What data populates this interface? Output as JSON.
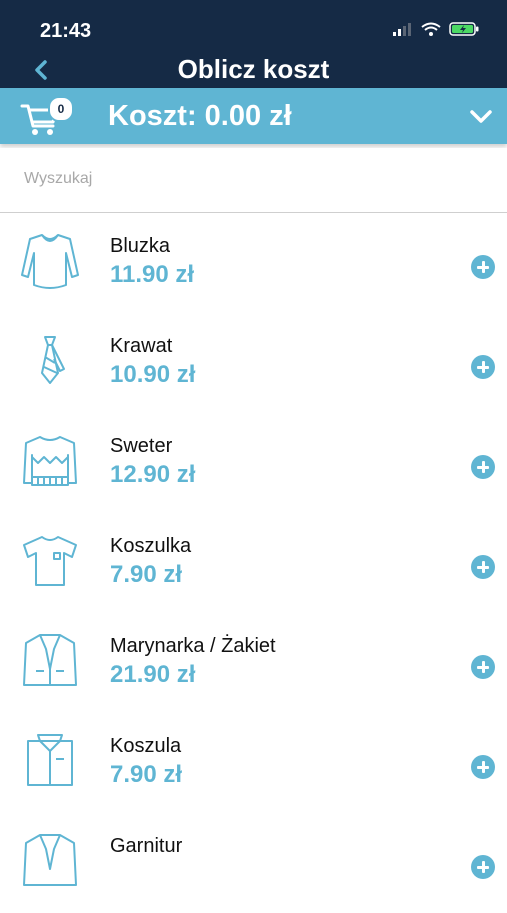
{
  "status": {
    "time": "21:43"
  },
  "nav": {
    "title": "Oblicz koszt",
    "back_icon": "chevron-left-icon"
  },
  "cost_bar": {
    "cart_count": "0",
    "label": "Koszt: 0.00 zł",
    "expand_icon": "chevron-down-icon"
  },
  "search": {
    "placeholder": "Wyszukaj",
    "value": ""
  },
  "items": [
    {
      "name": "Bluzka",
      "price": "11.90 zł",
      "icon": "blouse-icon"
    },
    {
      "name": "Krawat",
      "price": "10.90 zł",
      "icon": "tie-icon"
    },
    {
      "name": "Sweter",
      "price": "12.90 zł",
      "icon": "sweater-icon"
    },
    {
      "name": "Koszulka",
      "price": "7.90 zł",
      "icon": "tshirt-icon"
    },
    {
      "name": "Marynarka / Żakiet",
      "price": "21.90 zł",
      "icon": "jacket-icon"
    },
    {
      "name": "Koszula",
      "price": "7.90 zł",
      "icon": "shirt-icon"
    },
    {
      "name": "Garnitur",
      "price": "",
      "icon": "suit-icon"
    }
  ],
  "colors": {
    "header_dark": "#152a45",
    "accent": "#5fb5d3",
    "text": "#111111"
  }
}
